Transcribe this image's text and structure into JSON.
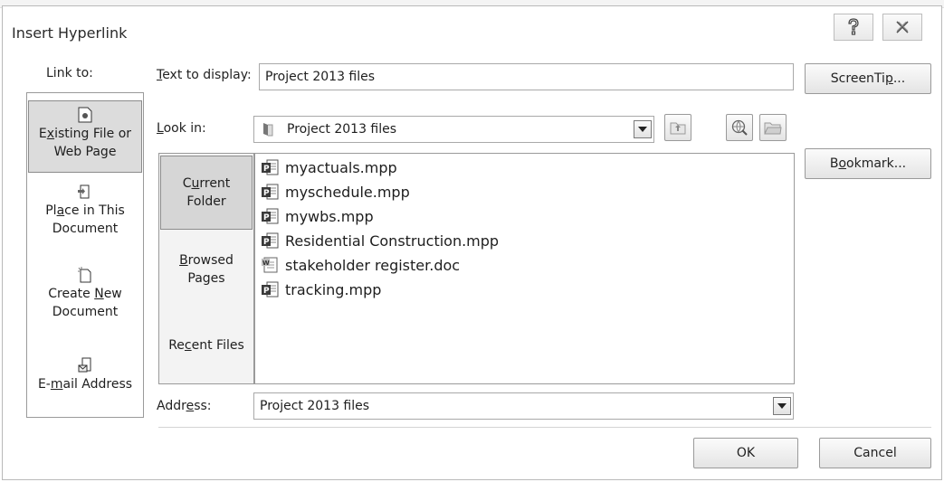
{
  "dialog": {
    "title": "Insert Hyperlink"
  },
  "titlebar": {
    "help_icon": "help-icon",
    "close_icon": "close-icon"
  },
  "link_to": {
    "label": "Link to:",
    "items": [
      {
        "icon": "existing-file-icon",
        "line1_pre": "E",
        "line1_key": "x",
        "line1_post": "isting File or",
        "line2": "Web Page",
        "selected": true
      },
      {
        "icon": "place-in-document-icon",
        "line1_pre": "Pl",
        "line1_key": "a",
        "line1_post": "ce in This",
        "line2": "Document",
        "selected": false
      },
      {
        "icon": "create-new-document-icon",
        "line1_pre": "Create ",
        "line1_key": "N",
        "line1_post": "ew",
        "line2": "Document",
        "selected": false
      },
      {
        "icon": "email-address-icon",
        "line1_pre": "E-",
        "line1_key": "m",
        "line1_post": "ail Address",
        "line2": "",
        "selected": false
      }
    ]
  },
  "text_to_display": {
    "label_key": "T",
    "label_rest": "ext to display:",
    "value": "Project 2013 files"
  },
  "look_in": {
    "label_key": "L",
    "label_rest": "ook in:",
    "value": "Project 2013 files"
  },
  "nav": {
    "current_folder": {
      "pre": "C",
      "key": "u",
      "post": "rrent",
      "line2": "Folder"
    },
    "browsed_pages": {
      "key": "B",
      "post": "rowsed",
      "line2": "Pages"
    },
    "recent_files": {
      "pre": "Re",
      "key": "c",
      "post": "ent Files"
    }
  },
  "files": [
    {
      "name": "myactuals.mpp",
      "icon": "project-file-icon"
    },
    {
      "name": "myschedule.mpp",
      "icon": "project-file-icon"
    },
    {
      "name": "mywbs.mpp",
      "icon": "project-file-icon"
    },
    {
      "name": "Residential Construction.mpp",
      "icon": "project-file-icon"
    },
    {
      "name": "stakeholder register.doc",
      "icon": "word-document-icon"
    },
    {
      "name": "tracking.mpp",
      "icon": "project-file-icon"
    }
  ],
  "address": {
    "label_pre": "Addr",
    "label_key": "e",
    "label_post": "ss:",
    "value": "Project 2013 files"
  },
  "buttons": {
    "screentip_pre": "ScreenTi",
    "screentip_key": "p",
    "screentip_post": "...",
    "bookmark_pre": "B",
    "bookmark_key": "o",
    "bookmark_post": "okmark...",
    "ok": "OK",
    "cancel": "Cancel"
  }
}
